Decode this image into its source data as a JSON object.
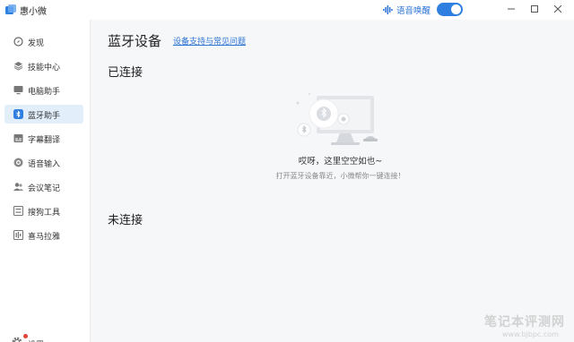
{
  "app": {
    "title": "惠小微"
  },
  "header": {
    "wake_label": "语音唤醒",
    "wake_enabled": true
  },
  "sidebar": {
    "items": [
      {
        "label": "发现",
        "icon": "discover-icon"
      },
      {
        "label": "技能中心",
        "icon": "layers-icon"
      },
      {
        "label": "电脑助手",
        "icon": "monitor-icon"
      },
      {
        "label": "蓝牙助手",
        "icon": "bluetooth-icon",
        "active": true
      },
      {
        "label": "字幕翻译",
        "icon": "subtitle-icon"
      },
      {
        "label": "语音输入",
        "icon": "voice-icon"
      },
      {
        "label": "会议笔记",
        "icon": "meeting-icon"
      },
      {
        "label": "搜狗工具",
        "icon": "tools-icon"
      },
      {
        "label": "喜马拉雅",
        "icon": "ximalaya-icon"
      }
    ],
    "settings_label": "设置"
  },
  "main": {
    "title": "蓝牙设备",
    "help_link": "设备支持与常见问题",
    "connected_title": "已连接",
    "empty_main": "哎呀，这里空空如也~",
    "empty_sub": "打开蓝牙设备靠近，小微帮你一键连接！",
    "disconnected_title": "未连接"
  },
  "watermark": {
    "main": "笔记本评测网",
    "sub": "www.bjbpc.com"
  },
  "colors": {
    "accent": "#2f7fe0",
    "link": "#2b73d6",
    "active_bg": "#e3eefb",
    "main_bg": "#f6f7f9"
  }
}
